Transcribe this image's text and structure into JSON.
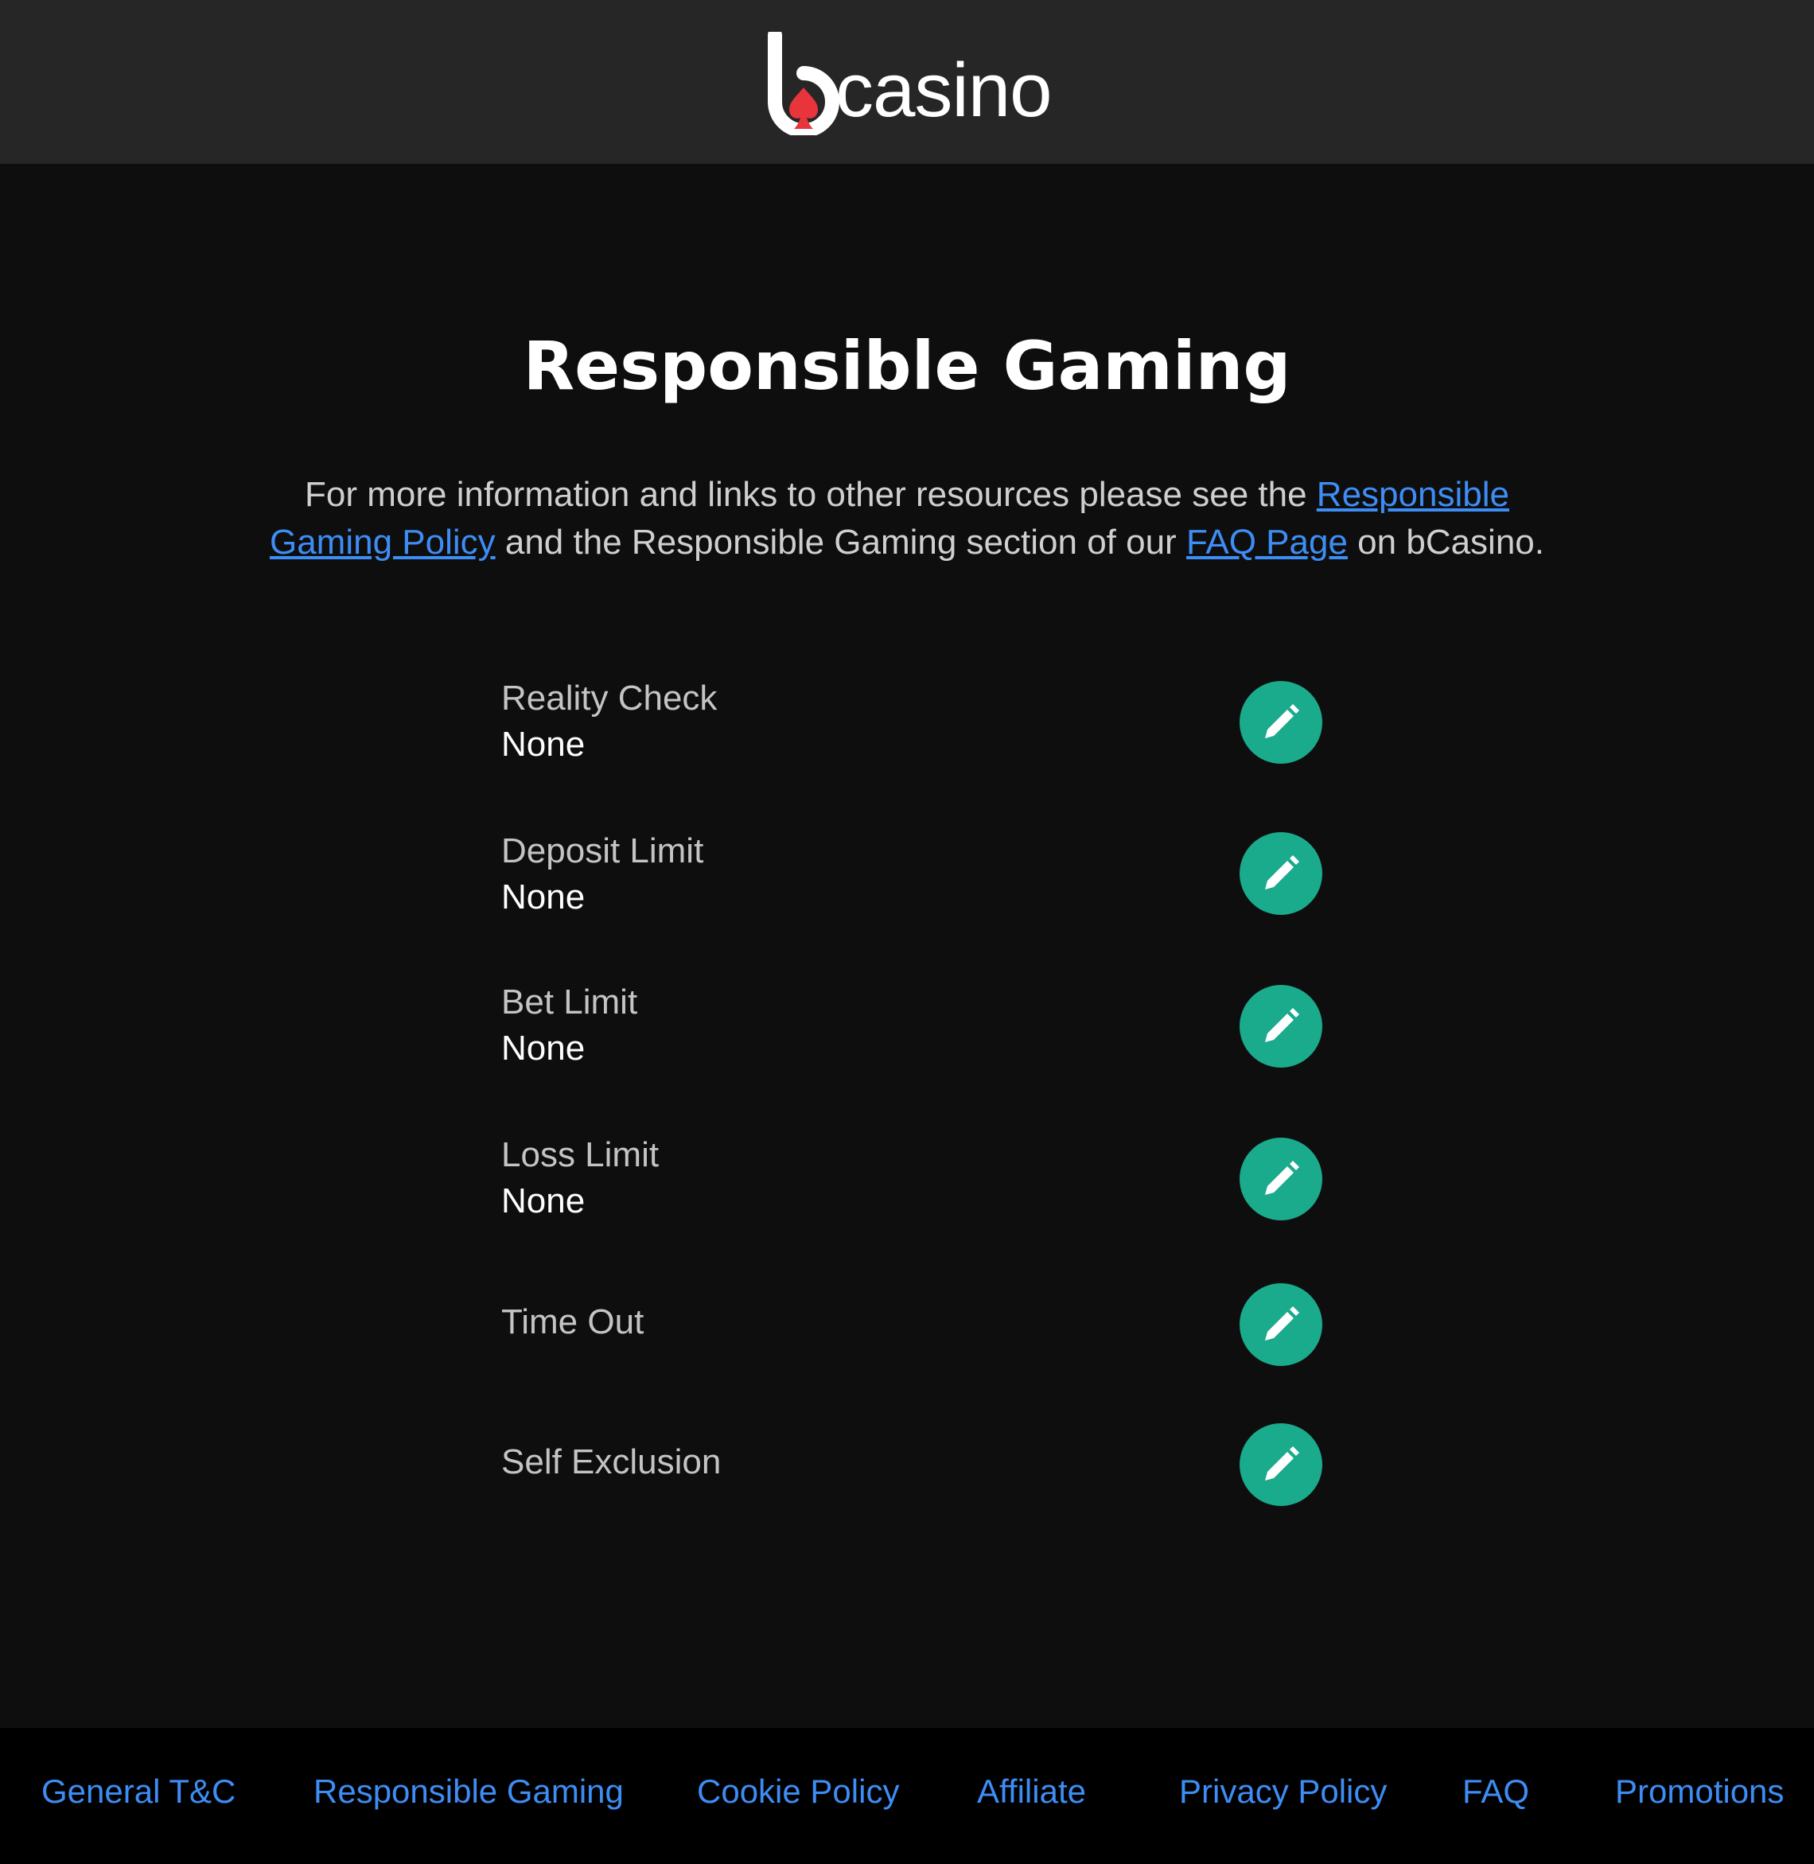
{
  "header": {
    "logo_text": "casino"
  },
  "page": {
    "title": "Responsible Gaming",
    "intro_prefix": "For more information and links to other resources please see the ",
    "policy_link": "Responsible Gaming Policy",
    "intro_middle": " and the Responsible Gaming section of our ",
    "faq_link": "FAQ Page",
    "intro_suffix": " on bCasino."
  },
  "settings": [
    {
      "label": "Reality Check",
      "value": "None"
    },
    {
      "label": "Deposit Limit",
      "value": "None"
    },
    {
      "label": "Bet Limit",
      "value": "None"
    },
    {
      "label": "Loss Limit",
      "value": "None"
    },
    {
      "label": "Time Out",
      "value": ""
    },
    {
      "label": "Self Exclusion",
      "value": ""
    }
  ],
  "edit_icon": "pencil-icon",
  "colors": {
    "accent": "#1aaa8c",
    "link": "#3d8df5",
    "header_bg": "#262626",
    "page_bg": "#0e0e0e",
    "footer_bg": "#000000",
    "logo_spade": "#e8343b"
  },
  "footer": {
    "links": [
      "General T&C",
      "Responsible Gaming",
      "Cookie Policy",
      "Affiliate",
      "Privacy Policy",
      "FAQ",
      "Promotions"
    ]
  }
}
